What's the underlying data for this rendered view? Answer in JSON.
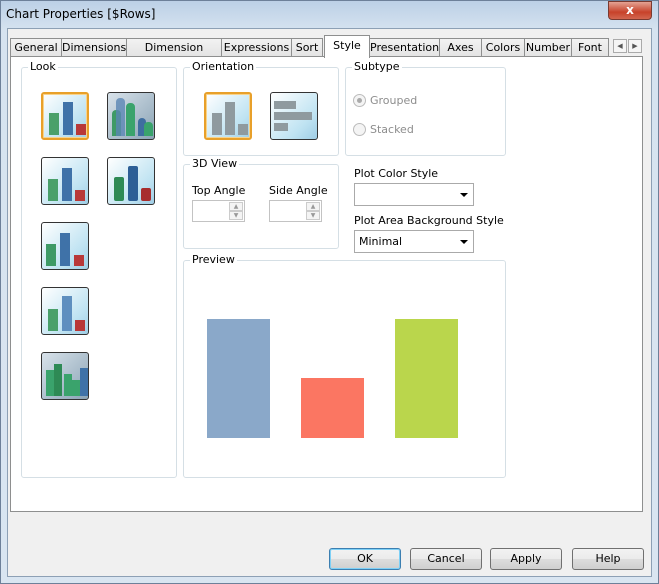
{
  "window": {
    "title": "Chart Properties [$Rows]",
    "close_label": "x"
  },
  "tabs": [
    {
      "label": "General"
    },
    {
      "label": "Dimensions"
    },
    {
      "label": "Dimension Limits"
    },
    {
      "label": "Expressions"
    },
    {
      "label": "Sort"
    },
    {
      "label": "Style",
      "active": true
    },
    {
      "label": "Presentation"
    },
    {
      "label": "Axes"
    },
    {
      "label": "Colors"
    },
    {
      "label": "Number"
    },
    {
      "label": "Font"
    }
  ],
  "tab_scroll": {
    "left": "◀",
    "right": "▶"
  },
  "look": {
    "label": "Look",
    "selected_index": 0,
    "options": [
      "flat-bars",
      "3d-cylinders",
      "shaded-bars",
      "glass-bars",
      "3d-bars",
      "tilted-bars",
      "3d-clustered"
    ]
  },
  "orientation": {
    "label": "Orientation",
    "selected": "vertical",
    "options": [
      "vertical",
      "horizontal"
    ]
  },
  "subtype": {
    "label": "Subtype",
    "grouped": "Grouped",
    "stacked": "Stacked",
    "selected": "Grouped",
    "enabled": false
  },
  "view3d": {
    "label": "3D View",
    "top_angle": "Top Angle",
    "side_angle": "Side Angle",
    "top_value": "",
    "side_value": ""
  },
  "plot_color_style": {
    "label": "Plot Color Style",
    "value": ""
  },
  "plot_area_bg": {
    "label": "Plot Area Background Style",
    "value": "Minimal"
  },
  "preview": {
    "label": "Preview",
    "bars": [
      {
        "value": 1.0,
        "color": "#8aa8c9"
      },
      {
        "value": 0.5,
        "color": "#fb7662"
      },
      {
        "value": 1.0,
        "color": "#bad64c"
      }
    ]
  },
  "buttons": {
    "ok": "OK",
    "cancel": "Cancel",
    "apply": "Apply",
    "help": "Help"
  }
}
